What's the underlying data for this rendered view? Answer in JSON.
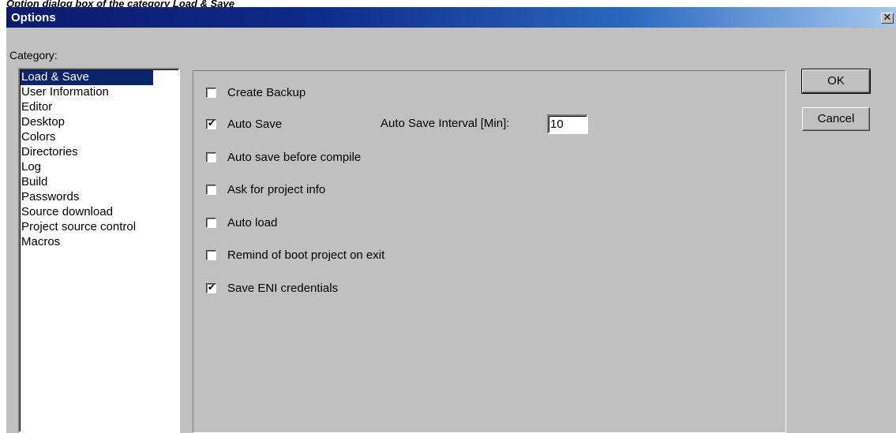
{
  "caption": "Option dialog box of the category Load & Save",
  "dialog": {
    "title": "Options",
    "close_glyph": "✕"
  },
  "category": {
    "label": "Category:",
    "items": [
      "Load & Save",
      "User Information",
      "Editor",
      "Desktop",
      "Colors",
      "Directories",
      "Log",
      "Build",
      "Passwords",
      "Source download",
      "Project source control",
      "Macros"
    ],
    "selected": "Load & Save"
  },
  "options": {
    "create_backup": {
      "label": "Create Backup",
      "checked": false
    },
    "auto_save": {
      "label": "Auto Save",
      "checked": true
    },
    "auto_save_before_compile": {
      "label": "Auto save before compile",
      "checked": false
    },
    "ask_project_info": {
      "label": "Ask for project info",
      "checked": false
    },
    "auto_load": {
      "label": "Auto load",
      "checked": false
    },
    "remind_boot_project": {
      "label": "Remind of boot project on exit",
      "checked": false
    },
    "save_eni_credentials": {
      "label": "Save ENI credentials",
      "checked": true
    },
    "check_glyph": "✔"
  },
  "auto_save_interval": {
    "label": "Auto Save Interval [Min]:",
    "value": "10"
  },
  "buttons": {
    "ok": "OK",
    "cancel": "Cancel"
  },
  "colors": {
    "selection": "#0a246a",
    "dialog_bg": "#c0c0c0"
  }
}
